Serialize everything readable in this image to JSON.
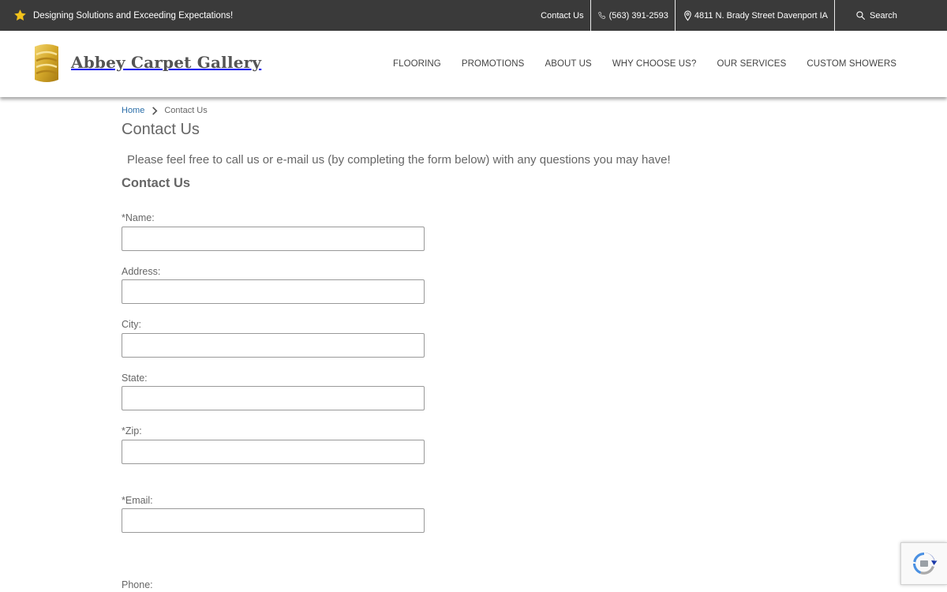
{
  "topbar": {
    "tagline": "Designing Solutions and Exceeding Expectations!",
    "contact_label": "Contact Us",
    "phone": "(563) 391-2593",
    "address": "4811 N. Brady Street Davenport IA",
    "search_label": "Search"
  },
  "header": {
    "brand": "Abbey Carpet Gallery",
    "nav": [
      "FLOORING",
      "PROMOTIONS",
      "ABOUT US",
      "WHY CHOOSE US?",
      "OUR SERVICES",
      "CUSTOM SHOWERS"
    ]
  },
  "breadcrumb": {
    "home": "Home",
    "current": "Contact Us"
  },
  "page": {
    "title": "Contact Us",
    "intro": "Please feel free to call us or e-mail us (by completing the form below) with any questions you may have!",
    "form_title": "Contact Us"
  },
  "form": {
    "fields": [
      {
        "label": "*Name:",
        "value": ""
      },
      {
        "label": "Address:",
        "value": ""
      },
      {
        "label": "City:",
        "value": ""
      },
      {
        "label": "State:",
        "value": ""
      },
      {
        "label": "*Zip:",
        "value": ""
      },
      {
        "label": "*Email:",
        "value": ""
      },
      {
        "label": "Phone:",
        "value": ""
      }
    ]
  },
  "colors": {
    "topbar_bg": "#3a3a3a",
    "link": "#2b6ea8",
    "logo_gold": "#d4a82a",
    "star": "#f2c21b"
  },
  "icons": {
    "tagline": "star-icon",
    "phone": "phone-icon",
    "address": "map-pin-icon",
    "search": "search-icon",
    "breadcrumb": "chevron-right-icon",
    "recaptcha": "recaptcha-icon"
  }
}
